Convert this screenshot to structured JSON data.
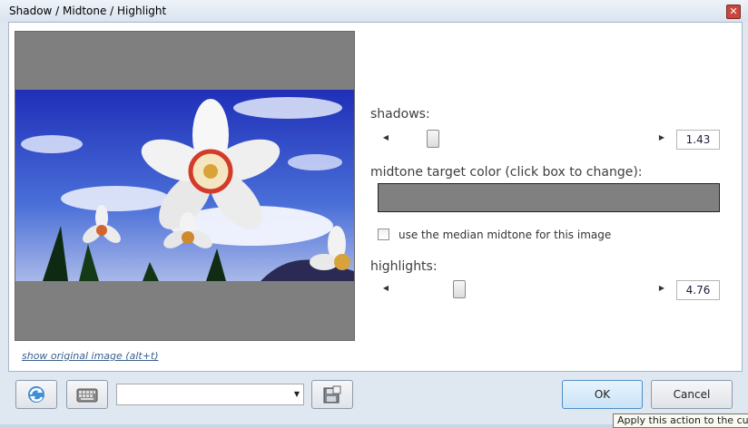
{
  "window": {
    "title": "Shadow / Midtone / Highlight",
    "close_glyph": "✕"
  },
  "preview": {
    "alt": "daffodil photo preview"
  },
  "shadows": {
    "label": "shadows:",
    "value": "1.43",
    "level_fraction": 0.12
  },
  "midtone": {
    "label": "midtone target color (click box to change):",
    "color": "#808080"
  },
  "median_checkbox": {
    "label": "use the median midtone for this image",
    "checked": false
  },
  "highlights": {
    "label": "highlights:",
    "value": "4.76",
    "level_fraction": 0.23
  },
  "show_original_link": "show original image (alt+t)",
  "footer": {
    "ok_label": "OK",
    "cancel_label": "Cancel",
    "preset_value": ""
  },
  "tooltip": "Apply this action to the curr"
}
